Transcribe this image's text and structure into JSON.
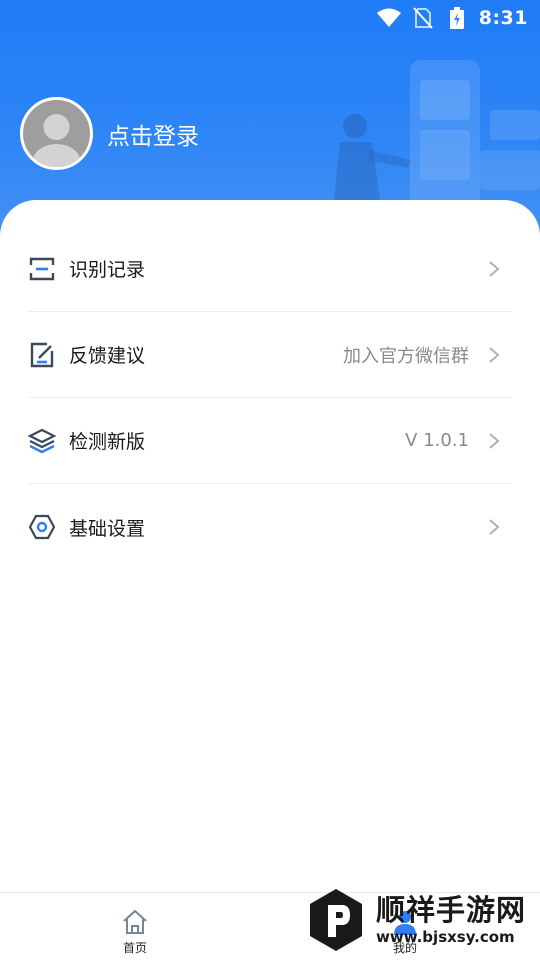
{
  "status_bar": {
    "time": "8:31",
    "icons": [
      "wifi-icon",
      "no-sim-icon",
      "battery-charging-icon"
    ]
  },
  "colors": {
    "header_blue": "#1f7cf7",
    "accent_blue": "#2d7ff3",
    "text_dark": "#1a1a1a",
    "text_gray": "#8a8a8a"
  },
  "profile": {
    "login_label": "点击登录",
    "avatar_icon": "default-avatar-icon"
  },
  "menu": {
    "items": [
      {
        "label": "识别记录",
        "extra": "",
        "icon": "scan-record-icon"
      },
      {
        "label": "反馈建议",
        "extra": "加入官方微信群",
        "icon": "feedback-edit-icon"
      },
      {
        "label": "检测新版",
        "extra": "V 1.0.1",
        "icon": "layers-icon"
      },
      {
        "label": "基础设置",
        "extra": "",
        "icon": "settings-hexagon-icon"
      }
    ]
  },
  "bottom_nav": {
    "home_label": "首页",
    "mine_label": "我的"
  },
  "watermark": {
    "title": "顺祥手游网",
    "url": "www.bjsxsy.com"
  }
}
